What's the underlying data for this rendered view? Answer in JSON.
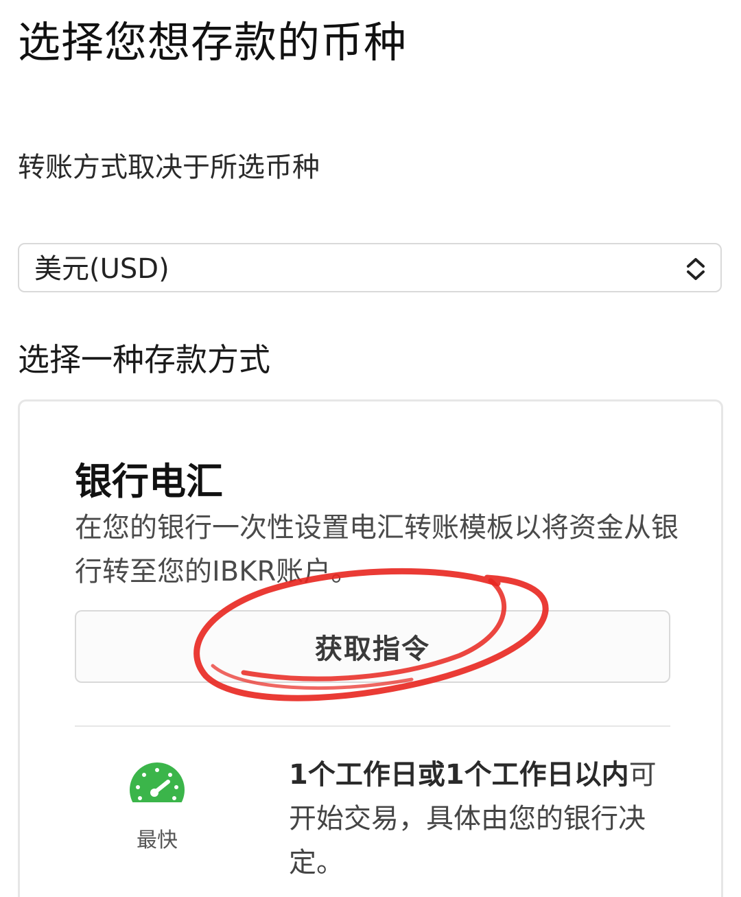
{
  "header": {
    "title": "选择您想存款的币种"
  },
  "currency": {
    "subtitle": "转账方式取决于所选币种",
    "selected": "美元(USD)",
    "arrow_icon": "chevron-up-down-icon"
  },
  "deposit": {
    "section_title": "选择一种存款方式",
    "method": {
      "name": "银行电汇",
      "description": "在您的银行一次性设置电汇转账模板以将资金从银行转至您的IBKR账户。",
      "button_label": "获取指令",
      "speed_icon": "speedometer-icon",
      "speed_label": "最快",
      "timing_strong": "1个工作日或1个工作日以内",
      "timing_rest": "可开始交易，具体由您的银行决定。"
    }
  },
  "colors": {
    "speed_green": "#3bb54a",
    "annotation_red": "#e8261f"
  }
}
